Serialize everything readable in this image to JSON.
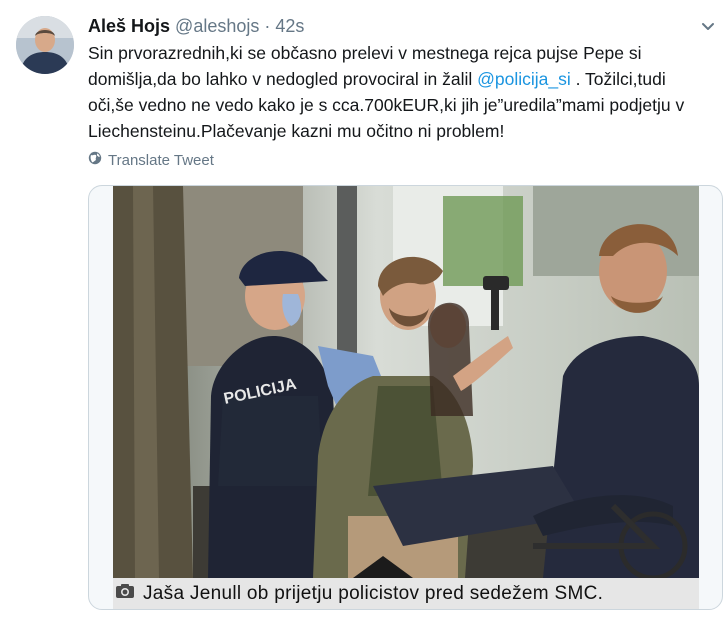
{
  "author": {
    "name": "Aleš Hojs",
    "handle": "@aleshojs",
    "separator": "·",
    "time": "42s"
  },
  "tweet": {
    "text_before": "Sin prvorazrednih,ki se občasno prelevi v mestnega rejca pujse Pepe si domišlja,da bo lahko v nedogled provociral in žalil ",
    "mention": "@policija_si",
    "text_after": " . Tožilci,tudi oči,še vedno ne vedo kako je s cca.700kEUR,ki jih je”uredila”mami podjetju v Liechensteinu.Plačevanje kazni mu očitno ni problem!"
  },
  "translate_label": "Translate Tweet",
  "media": {
    "caption": "Jaša Jenull ob prijetju policistov pred sedežem SMC.",
    "vest_text": "POLICIJA"
  },
  "icons": {
    "globe": "globe-icon",
    "caret": "chevron-down-icon",
    "camera": "camera-icon"
  },
  "colors": {
    "link": "#1b95e0",
    "secondary_text": "#657786",
    "border": "#ccd6dd"
  }
}
